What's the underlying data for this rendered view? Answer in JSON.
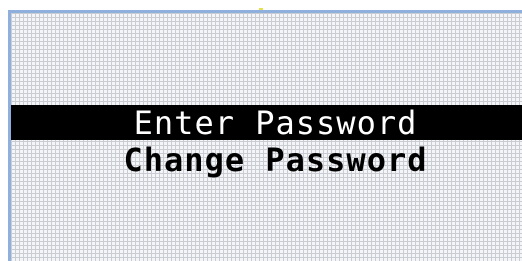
{
  "menu": {
    "items": [
      {
        "label": "Enter Password",
        "selected": true
      },
      {
        "label": "Change Password",
        "selected": false
      }
    ]
  },
  "colors": {
    "frame_border": "#8fb0dc",
    "pixel_grid": "#c9cdd3",
    "screen_bg": "#f4f5f7",
    "highlight_bg": "#000000",
    "highlight_text": "#ffffff",
    "text": "#000000",
    "marker": "#e8e04a"
  }
}
